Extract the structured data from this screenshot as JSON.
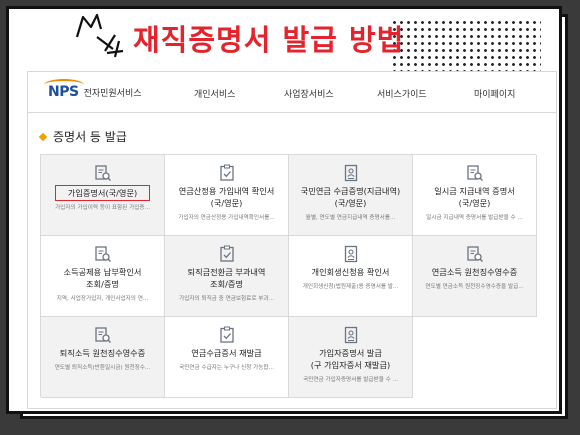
{
  "headline": "재직증명서 발급 방법",
  "brand": {
    "mark": "NPS",
    "name": "전자민원서비스"
  },
  "nav": [
    {
      "label": "개인서비스"
    },
    {
      "label": "사업장서비스"
    },
    {
      "label": "서비스가이드"
    },
    {
      "label": "마이페이지"
    }
  ],
  "section_title": "증명서 등 발급",
  "cards": [
    {
      "title": "가입증명서(국/영문)",
      "desc": "가입자의 가입이력 등이 표함된 가입증...",
      "icon": "doc-search-icon",
      "highlighted": true
    },
    {
      "title": "연금산정용 가입내역 확인서\n(국/영문)",
      "desc": "가입자의 연금산정용 가입내역확인서를...",
      "icon": "checklist-icon",
      "highlighted": false
    },
    {
      "title": "국민연금 수급증명(지급내역)\n(국/영문)",
      "desc": "월별, 연도별 연금지급내역 증명서를...",
      "icon": "person-doc-icon",
      "highlighted": false
    },
    {
      "title": "일시금 지급내역 증명서\n(국/영문)",
      "desc": "일시금 지급내역 증명서를 발급받을 수 ...",
      "icon": "doc-search-icon",
      "highlighted": false
    },
    {
      "title": "소득공제용 납부확인서\n조회/증명",
      "desc": "지역, 사업장가입자, 개인사업자의 연...",
      "icon": "doc-search-icon",
      "highlighted": false
    },
    {
      "title": "퇴직금전환금 부과내역\n조회/증명",
      "desc": "가입자의 퇴직금 중 연금보험료로 부과...",
      "icon": "checklist-icon",
      "highlighted": false
    },
    {
      "title": "개인회생신청용 확인서",
      "desc": "개인회생신청(법원제출)용 증명서를 발...",
      "icon": "person-doc-icon",
      "highlighted": false
    },
    {
      "title": "연금소득 원천징수영수증",
      "desc": "연도별 연금소득 원천징수영수증을 발급...",
      "icon": "doc-search-icon",
      "highlighted": false
    },
    {
      "title": "퇴직소득 원천징수영수증",
      "desc": "연도별 퇴직소득(반환일시금) 원천징수...",
      "icon": "doc-search-icon",
      "highlighted": false
    },
    {
      "title": "연금수급증서 재발급",
      "desc": "국민연금 수급자는 누구나 신청 가능합...",
      "icon": "checklist-icon",
      "highlighted": false
    },
    {
      "title": "가입자증명서 발급\n(구 가입자증서 재발급)",
      "desc": "국민연금 가입자증명서를 발급받을 수 ...",
      "icon": "person-doc-icon",
      "highlighted": false
    }
  ],
  "colors": {
    "accent": "#e4232c",
    "brand": "#1c4f9c",
    "brand_secondary": "#f18a00",
    "bullet": "#f2a200"
  }
}
